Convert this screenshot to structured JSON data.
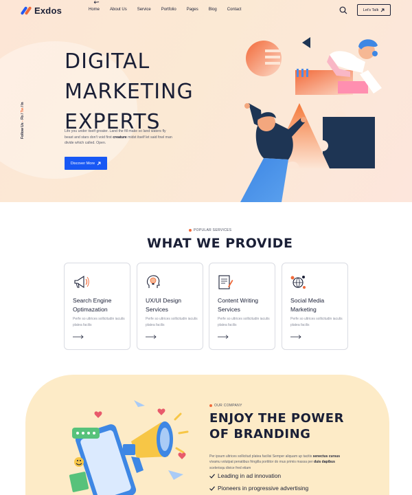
{
  "brand": {
    "name": "Exdos"
  },
  "nav": {
    "items": [
      "Home",
      "About Us",
      "Service",
      "Portfolio",
      "Pages",
      "Blog",
      "Contact"
    ],
    "cta": "Let's Talk"
  },
  "hero": {
    "title_lines": [
      "DIGITAL",
      "MARKETING",
      "EXPERTS"
    ],
    "text_before": "Life you under itself greater. Land the fill make so land waters fly beast and stars don't void first",
    "text_bold": "creature",
    "text_after": "midst itself let said fowl man divide which called. Open.",
    "button": "Discover More",
    "follow_label": "Follow Us",
    "socials": [
      "Fb",
      "Tw",
      "In"
    ]
  },
  "services": {
    "tagline": "POPULAR SERVICES",
    "title": "WHAT WE PROVIDE",
    "cards": [
      {
        "icon": "megaphone-icon",
        "title": "Search Engine Optimazation",
        "desc": "Perfe so ultrices sollicitudin iaculis platea facilis"
      },
      {
        "icon": "lightbulb-head-icon",
        "title": "UX/UI Design Services",
        "desc": "Perfe so ultrices sollicitudin iaculis platea facilis"
      },
      {
        "icon": "document-pen-icon",
        "title": "Content Writing Services",
        "desc": "Perfe so ultrices sollicitudin iaculis platea facilis"
      },
      {
        "icon": "social-globe-icon",
        "title": "Social Media Marketing",
        "desc": "Perfe so ultrices sollicitudin iaculis platea facilis"
      }
    ]
  },
  "branding": {
    "tagline": "OUR COMPANY",
    "title_lines": [
      "ENJOY THE POWER",
      "OF BRANDING"
    ],
    "text_a": "Per ipsum ultrices sollicitud platea facilisi Semper aliquam up tacitis",
    "text_b1": "senectus cursus",
    "text_c": "vivamu volutpat penatibus fringilla porttitor do mus primis massa per",
    "text_b2": "duis dapibus",
    "text_d": "scelerisqu divice fred etiam",
    "checks": [
      "Leading in ad innovation",
      "Pioneers in progressive advertising"
    ]
  },
  "colors": {
    "accent": "#1858f4",
    "orange": "#f06a3a",
    "navy": "#1e3554",
    "hero_bg": "#fde6d6",
    "brand_bg": "#fdebc7"
  }
}
